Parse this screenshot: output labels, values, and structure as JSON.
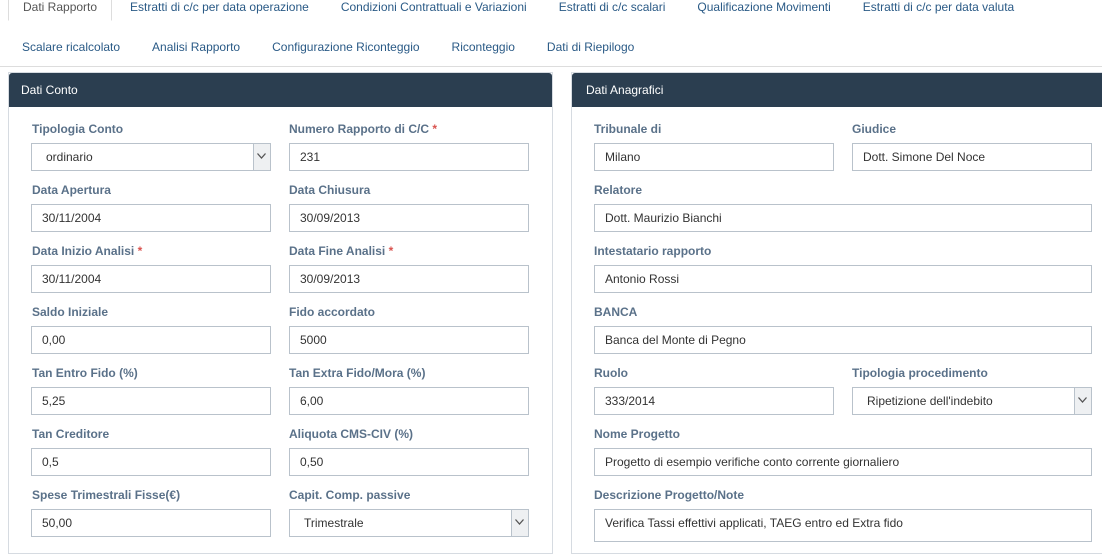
{
  "tabs_row1": [
    "Dati Rapporto",
    "Estratti di c/c per data operazione",
    "Condizioni Contrattuali e Variazioni",
    "Estratti di c/c scalari",
    "Qualificazione Movimenti",
    "Estratti di c/c per data valuta"
  ],
  "tabs_row2": [
    "Scalare ricalcolato",
    "Analisi Rapporto",
    "Configurazione Riconteggio",
    "Riconteggio",
    "Dati di Riepilogo"
  ],
  "left_panel": {
    "title": "Dati Conto",
    "tipologia_conto": {
      "label": "Tipologia Conto",
      "value": "ordinario"
    },
    "numero_rapporto": {
      "label": "Numero Rapporto di C/C",
      "value": "231"
    },
    "data_apertura": {
      "label": "Data Apertura",
      "value": "30/11/2004"
    },
    "data_chiusura": {
      "label": "Data Chiusura",
      "value": "30/09/2013"
    },
    "data_inizio": {
      "label": "Data Inizio Analisi",
      "value": "30/11/2004"
    },
    "data_fine": {
      "label": "Data Fine Analisi",
      "value": "30/09/2013"
    },
    "saldo_iniziale": {
      "label": "Saldo Iniziale",
      "value": "0,00"
    },
    "fido_accordato": {
      "label": "Fido accordato",
      "value": "5000"
    },
    "tan_entro": {
      "label": "Tan Entro Fido (%)",
      "value": "5,25"
    },
    "tan_extra": {
      "label": "Tan Extra Fido/Mora (%)",
      "value": "6,00"
    },
    "tan_creditore": {
      "label": "Tan Creditore",
      "value": "0,5"
    },
    "aliquota": {
      "label": "Aliquota CMS-CIV (%)",
      "value": "0,50"
    },
    "spese": {
      "label": "Spese Trimestrali Fisse(€)",
      "value": "50,00"
    },
    "capit": {
      "label": "Capit. Comp. passive",
      "value": "Trimestrale"
    },
    "required_mark": "*"
  },
  "right_panel": {
    "title": "Dati Anagrafici",
    "tribunale": {
      "label": "Tribunale di",
      "value": "Milano"
    },
    "giudice": {
      "label": "Giudice",
      "value": "Dott. Simone Del Noce"
    },
    "relatore": {
      "label": "Relatore",
      "value": "Dott. Maurizio Bianchi"
    },
    "intestatario": {
      "label": "Intestatario rapporto",
      "value": "Antonio Rossi"
    },
    "banca": {
      "label": "BANCA",
      "value": "Banca del Monte di Pegno"
    },
    "ruolo": {
      "label": "Ruolo",
      "value": "333/2014"
    },
    "tipologia_proc": {
      "label": "Tipologia procedimento",
      "value": "Ripetizione dell'indebito"
    },
    "nome_progetto": {
      "label": "Nome Progetto",
      "value": "Progetto di esempio verifiche conto corrente giornaliero"
    },
    "descrizione": {
      "label": "Descrizione Progetto/Note",
      "value": "Verifica Tassi effettivi applicati, TAEG entro ed Extra fido"
    }
  }
}
